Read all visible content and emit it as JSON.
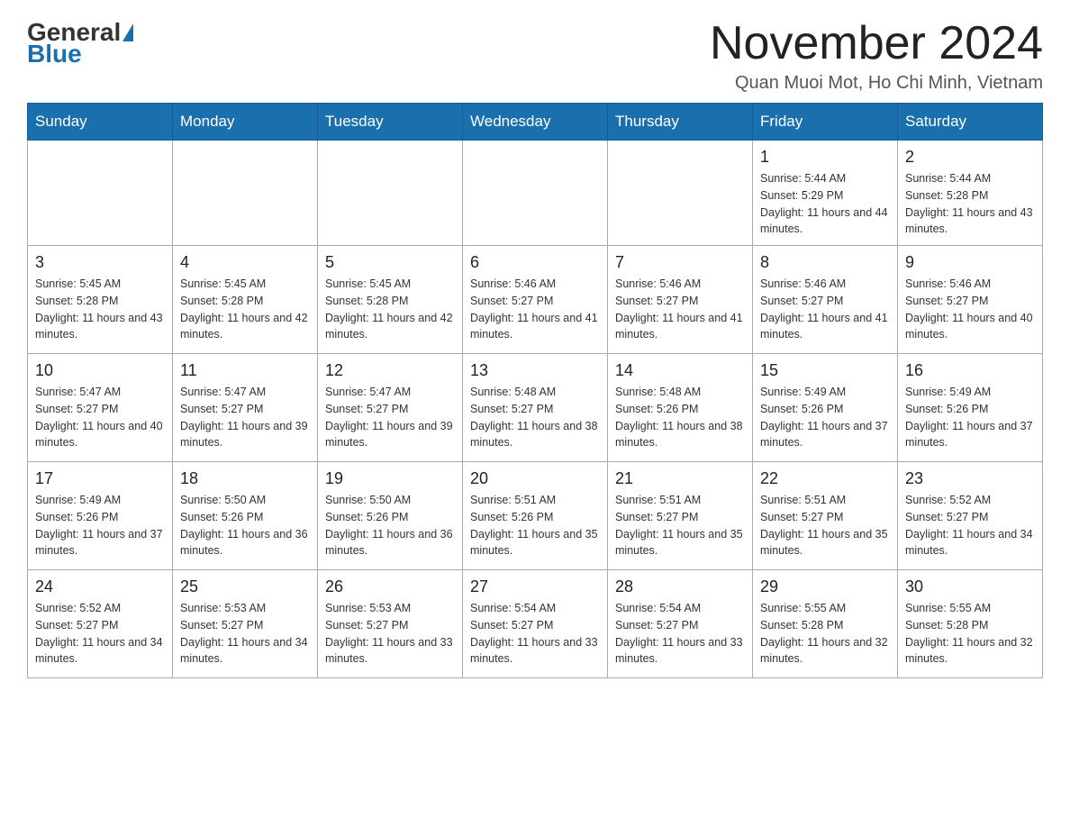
{
  "logo": {
    "general": "General",
    "blue": "Blue"
  },
  "title": "November 2024",
  "subtitle": "Quan Muoi Mot, Ho Chi Minh, Vietnam",
  "days_of_week": [
    "Sunday",
    "Monday",
    "Tuesday",
    "Wednesday",
    "Thursday",
    "Friday",
    "Saturday"
  ],
  "weeks": [
    [
      {
        "day": "",
        "info": ""
      },
      {
        "day": "",
        "info": ""
      },
      {
        "day": "",
        "info": ""
      },
      {
        "day": "",
        "info": ""
      },
      {
        "day": "",
        "info": ""
      },
      {
        "day": "1",
        "info": "Sunrise: 5:44 AM\nSunset: 5:29 PM\nDaylight: 11 hours and 44 minutes."
      },
      {
        "day": "2",
        "info": "Sunrise: 5:44 AM\nSunset: 5:28 PM\nDaylight: 11 hours and 43 minutes."
      }
    ],
    [
      {
        "day": "3",
        "info": "Sunrise: 5:45 AM\nSunset: 5:28 PM\nDaylight: 11 hours and 43 minutes."
      },
      {
        "day": "4",
        "info": "Sunrise: 5:45 AM\nSunset: 5:28 PM\nDaylight: 11 hours and 42 minutes."
      },
      {
        "day": "5",
        "info": "Sunrise: 5:45 AM\nSunset: 5:28 PM\nDaylight: 11 hours and 42 minutes."
      },
      {
        "day": "6",
        "info": "Sunrise: 5:46 AM\nSunset: 5:27 PM\nDaylight: 11 hours and 41 minutes."
      },
      {
        "day": "7",
        "info": "Sunrise: 5:46 AM\nSunset: 5:27 PM\nDaylight: 11 hours and 41 minutes."
      },
      {
        "day": "8",
        "info": "Sunrise: 5:46 AM\nSunset: 5:27 PM\nDaylight: 11 hours and 41 minutes."
      },
      {
        "day": "9",
        "info": "Sunrise: 5:46 AM\nSunset: 5:27 PM\nDaylight: 11 hours and 40 minutes."
      }
    ],
    [
      {
        "day": "10",
        "info": "Sunrise: 5:47 AM\nSunset: 5:27 PM\nDaylight: 11 hours and 40 minutes."
      },
      {
        "day": "11",
        "info": "Sunrise: 5:47 AM\nSunset: 5:27 PM\nDaylight: 11 hours and 39 minutes."
      },
      {
        "day": "12",
        "info": "Sunrise: 5:47 AM\nSunset: 5:27 PM\nDaylight: 11 hours and 39 minutes."
      },
      {
        "day": "13",
        "info": "Sunrise: 5:48 AM\nSunset: 5:27 PM\nDaylight: 11 hours and 38 minutes."
      },
      {
        "day": "14",
        "info": "Sunrise: 5:48 AM\nSunset: 5:26 PM\nDaylight: 11 hours and 38 minutes."
      },
      {
        "day": "15",
        "info": "Sunrise: 5:49 AM\nSunset: 5:26 PM\nDaylight: 11 hours and 37 minutes."
      },
      {
        "day": "16",
        "info": "Sunrise: 5:49 AM\nSunset: 5:26 PM\nDaylight: 11 hours and 37 minutes."
      }
    ],
    [
      {
        "day": "17",
        "info": "Sunrise: 5:49 AM\nSunset: 5:26 PM\nDaylight: 11 hours and 37 minutes."
      },
      {
        "day": "18",
        "info": "Sunrise: 5:50 AM\nSunset: 5:26 PM\nDaylight: 11 hours and 36 minutes."
      },
      {
        "day": "19",
        "info": "Sunrise: 5:50 AM\nSunset: 5:26 PM\nDaylight: 11 hours and 36 minutes."
      },
      {
        "day": "20",
        "info": "Sunrise: 5:51 AM\nSunset: 5:26 PM\nDaylight: 11 hours and 35 minutes."
      },
      {
        "day": "21",
        "info": "Sunrise: 5:51 AM\nSunset: 5:27 PM\nDaylight: 11 hours and 35 minutes."
      },
      {
        "day": "22",
        "info": "Sunrise: 5:51 AM\nSunset: 5:27 PM\nDaylight: 11 hours and 35 minutes."
      },
      {
        "day": "23",
        "info": "Sunrise: 5:52 AM\nSunset: 5:27 PM\nDaylight: 11 hours and 34 minutes."
      }
    ],
    [
      {
        "day": "24",
        "info": "Sunrise: 5:52 AM\nSunset: 5:27 PM\nDaylight: 11 hours and 34 minutes."
      },
      {
        "day": "25",
        "info": "Sunrise: 5:53 AM\nSunset: 5:27 PM\nDaylight: 11 hours and 34 minutes."
      },
      {
        "day": "26",
        "info": "Sunrise: 5:53 AM\nSunset: 5:27 PM\nDaylight: 11 hours and 33 minutes."
      },
      {
        "day": "27",
        "info": "Sunrise: 5:54 AM\nSunset: 5:27 PM\nDaylight: 11 hours and 33 minutes."
      },
      {
        "day": "28",
        "info": "Sunrise: 5:54 AM\nSunset: 5:27 PM\nDaylight: 11 hours and 33 minutes."
      },
      {
        "day": "29",
        "info": "Sunrise: 5:55 AM\nSunset: 5:28 PM\nDaylight: 11 hours and 32 minutes."
      },
      {
        "day": "30",
        "info": "Sunrise: 5:55 AM\nSunset: 5:28 PM\nDaylight: 11 hours and 32 minutes."
      }
    ]
  ]
}
